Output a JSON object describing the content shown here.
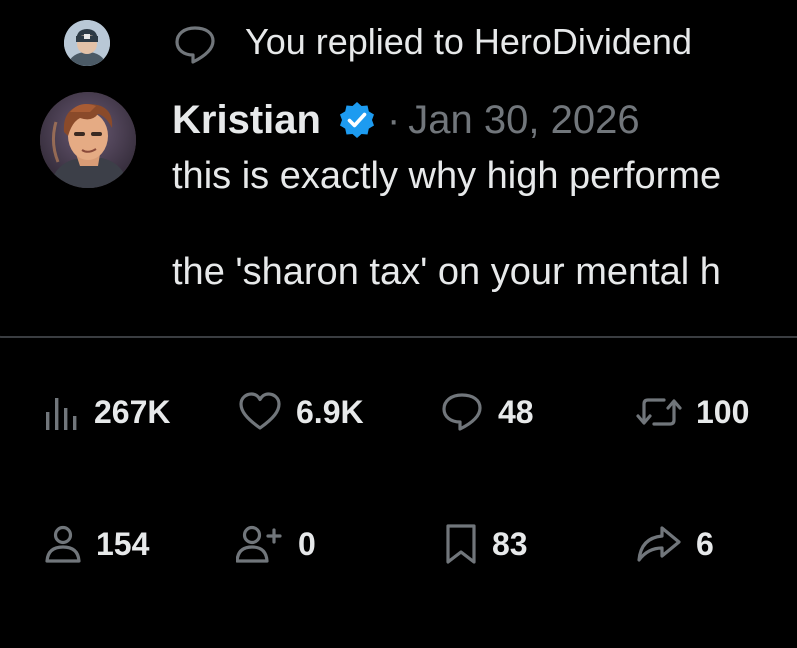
{
  "context": {
    "text": "You replied to HeroDividend"
  },
  "tweet": {
    "author_name": "Kristian",
    "dot": "·",
    "date": "Jan 30, 2026",
    "lines": [
      "this is exactly why high performe",
      "the 'sharon tax' on your mental h"
    ]
  },
  "stats": {
    "views": "267K",
    "likes": "6.9K",
    "replies": "48",
    "reposts": "100",
    "profile_visits": "154",
    "follows": "0",
    "bookmarks": "83",
    "shares": "6"
  },
  "colors": {
    "background": "#000000",
    "text": "#e7e9ea",
    "muted": "#71767b",
    "verified": "#1d9bf0",
    "border": "#3a3d41"
  },
  "icons": {
    "reply_context": "speech-bubble-icon",
    "verified": "verified-badge-icon",
    "views": "bar-chart-icon",
    "likes": "heart-icon",
    "replies": "comment-icon",
    "reposts": "repost-icon",
    "profile_visits": "person-icon",
    "follows": "person-plus-icon",
    "bookmarks": "bookmark-icon",
    "shares": "share-arrow-icon"
  }
}
